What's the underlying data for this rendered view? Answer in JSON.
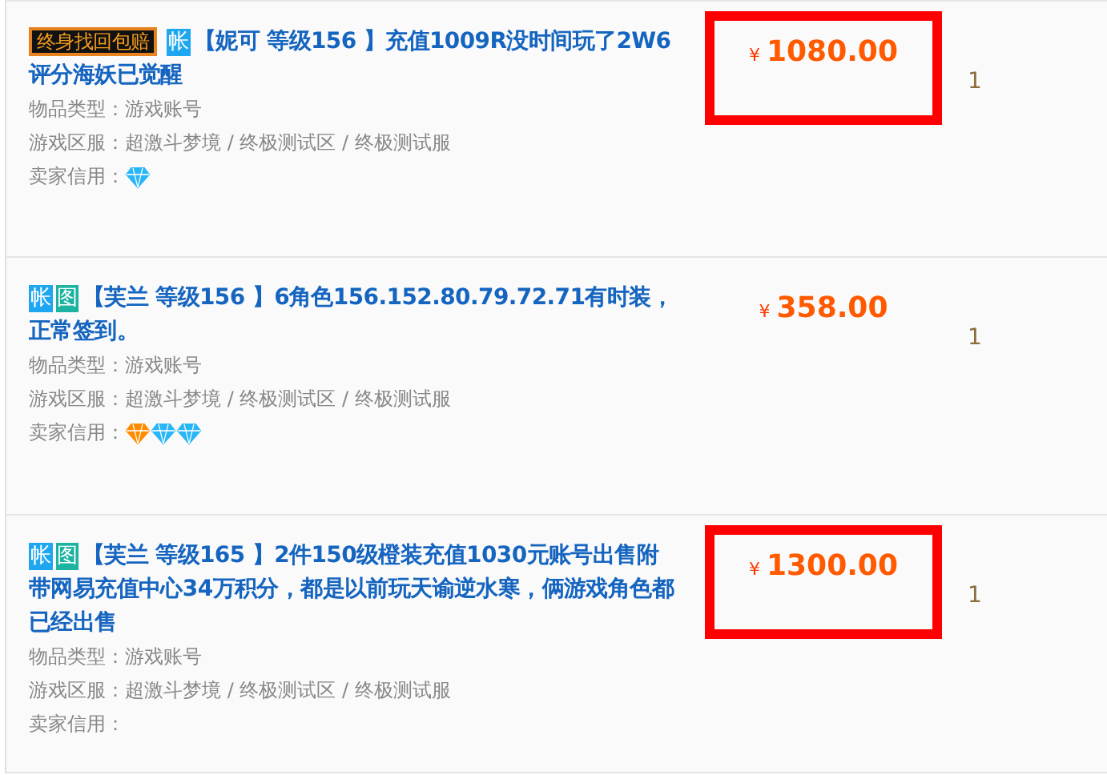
{
  "listings": [
    {
      "badge": "终身找回包赔",
      "tags": [
        {
          "kind": "account",
          "label": "帐"
        }
      ],
      "title": "【妮可 等级156 】充值1009R没时间玩了2W6评分海妖已觉醒",
      "type_label": "物品类型：",
      "type_value": "游戏账号",
      "server_label": "游戏区服：",
      "server_value": "超激斗梦境 / 终极测试区 / 终极测试服",
      "credit_label": "卖家信用：",
      "credit": [
        {
          "color": "#29b6f6"
        }
      ],
      "currency": "¥",
      "price": "1080.00",
      "highlighted": true,
      "quantity": "1"
    },
    {
      "tags": [
        {
          "kind": "account",
          "label": "帐"
        },
        {
          "kind": "image",
          "label": "图"
        }
      ],
      "title": "【芙兰 等级156 】6角色156.152.80.79.72.71有时装，正常签到。",
      "type_label": "物品类型：",
      "type_value": "游戏账号",
      "server_label": "游戏区服：",
      "server_value": "超激斗梦境 / 终极测试区 / 终极测试服",
      "credit_label": "卖家信用：",
      "credit": [
        {
          "color": "#ff8c00"
        },
        {
          "color": "#29b6f6"
        },
        {
          "color": "#29b6f6"
        }
      ],
      "currency": "¥",
      "price": "358.00",
      "highlighted": false,
      "quantity": "1"
    },
    {
      "tags": [
        {
          "kind": "account",
          "label": "帐"
        },
        {
          "kind": "image",
          "label": "图"
        }
      ],
      "title": "【芙兰 等级165 】2件150级橙装充值1030元账号出售附带网易充值中心34万积分，都是以前玩天谕逆水寒，俩游戏角色都已经出售",
      "type_label": "物品类型：",
      "type_value": "游戏账号",
      "server_label": "游戏区服：",
      "server_value": "超激斗梦境 / 终极测试区 / 终极测试服",
      "credit_label": "卖家信用：",
      "currency": "¥",
      "price": "1300.00",
      "highlighted": true,
      "quantity": "1"
    }
  ]
}
